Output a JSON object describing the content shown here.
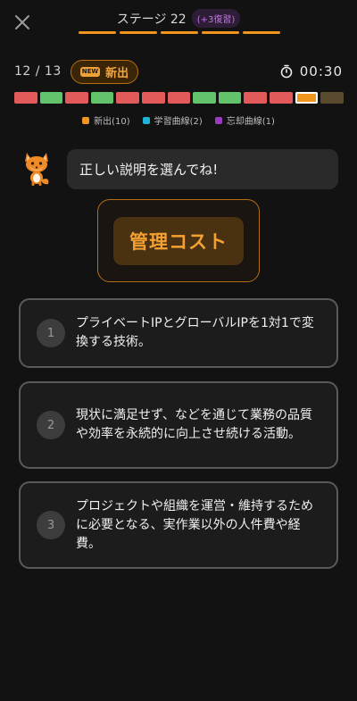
{
  "header": {
    "stage_title": "ステージ 22",
    "review_badge": "(+3復習)",
    "stage_segment_count": 5
  },
  "progress": {
    "counter": "12 / 13",
    "new_chip_icon": "NEW",
    "new_chip_label": "新出",
    "timer": "00:30",
    "blocks": [
      "red",
      "green",
      "red",
      "green",
      "red",
      "red",
      "red",
      "green",
      "green",
      "red",
      "red",
      "current",
      "pending"
    ]
  },
  "legend": [
    {
      "label": "新出(10)",
      "color": "#f0961e"
    },
    {
      "label": "学習曲線(2)",
      "color": "#1fb4d6"
    },
    {
      "label": "忘却曲線(1)",
      "color": "#9b3bbf"
    }
  ],
  "prompt": {
    "text": "正しい説明を選んでね!"
  },
  "term": {
    "text": "管理コスト"
  },
  "options": [
    {
      "number": "1",
      "text": "プライベートIPとグローバルIPを1対1で変換する技術。"
    },
    {
      "number": "2",
      "text": "現状に満足せず、などを通じて業務の品質や効率を永続的に向上させ続ける活動。"
    },
    {
      "number": "3",
      "text": "プロジェクトや組織を運営・維持するために必要となる、実作業以外の人件費や経費。"
    }
  ]
}
